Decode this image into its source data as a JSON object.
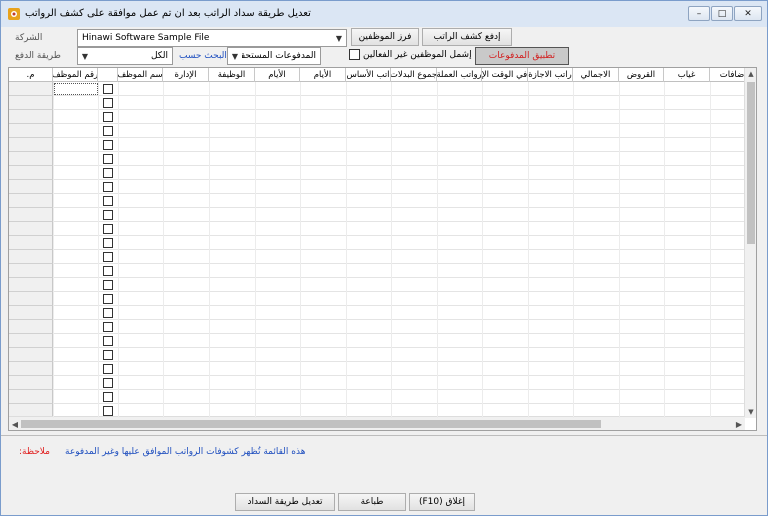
{
  "window": {
    "title": "تعديل طريقة سداد الراتب بعد ان تم عمل موافقة على كشف الرواتب",
    "min_glyph": "–",
    "max_glyph": "□",
    "close_glyph": "✕"
  },
  "toolbar": {
    "pay_payroll_label": "إدفع كشف الراتب",
    "sort_employees_label": "فرز الموظفين",
    "apply_payments_label": "تطبيق المدفوعات",
    "include_inactive_label": "إشمل الموظفين غير الفعالين"
  },
  "filters": {
    "company_label": "الشركة",
    "company_value": "Hinawi Software Sample File",
    "payment_method_label": "طريقة الدفع",
    "payment_method_value": "الكل",
    "search_by_label": "البحث حسب",
    "search_by_value": "المدفوعات المستحقة",
    "dropdown_arrow": "▼"
  },
  "grid": {
    "columns": [
      "م.",
      "رقم الموظف",
      "",
      "سم الموظف",
      "الإدارة",
      "الوظيفة",
      "الأيام",
      "الأيام",
      "اتب الأساس",
      "جموع البدلات",
      "رواتب العملة",
      "في الوقت الإ",
      "راتب الاجازة",
      "الاجمالي",
      "القروض",
      "غياب",
      "ضافات"
    ],
    "row_count": 24,
    "scroll_up": "▲",
    "scroll_down": "▼",
    "scroll_left": "◀",
    "scroll_right": "▶"
  },
  "footer": {
    "note_label": "ملاحظة:",
    "note_text": "هذه القائمة تُظهر كشوفات الرواتب الموافق عليها وغير المدفوعة",
    "edit_payment_method_label": "تعديل طريقة السداد",
    "print_label": "طباعة",
    "close_label": "إغلاق (F10)"
  }
}
